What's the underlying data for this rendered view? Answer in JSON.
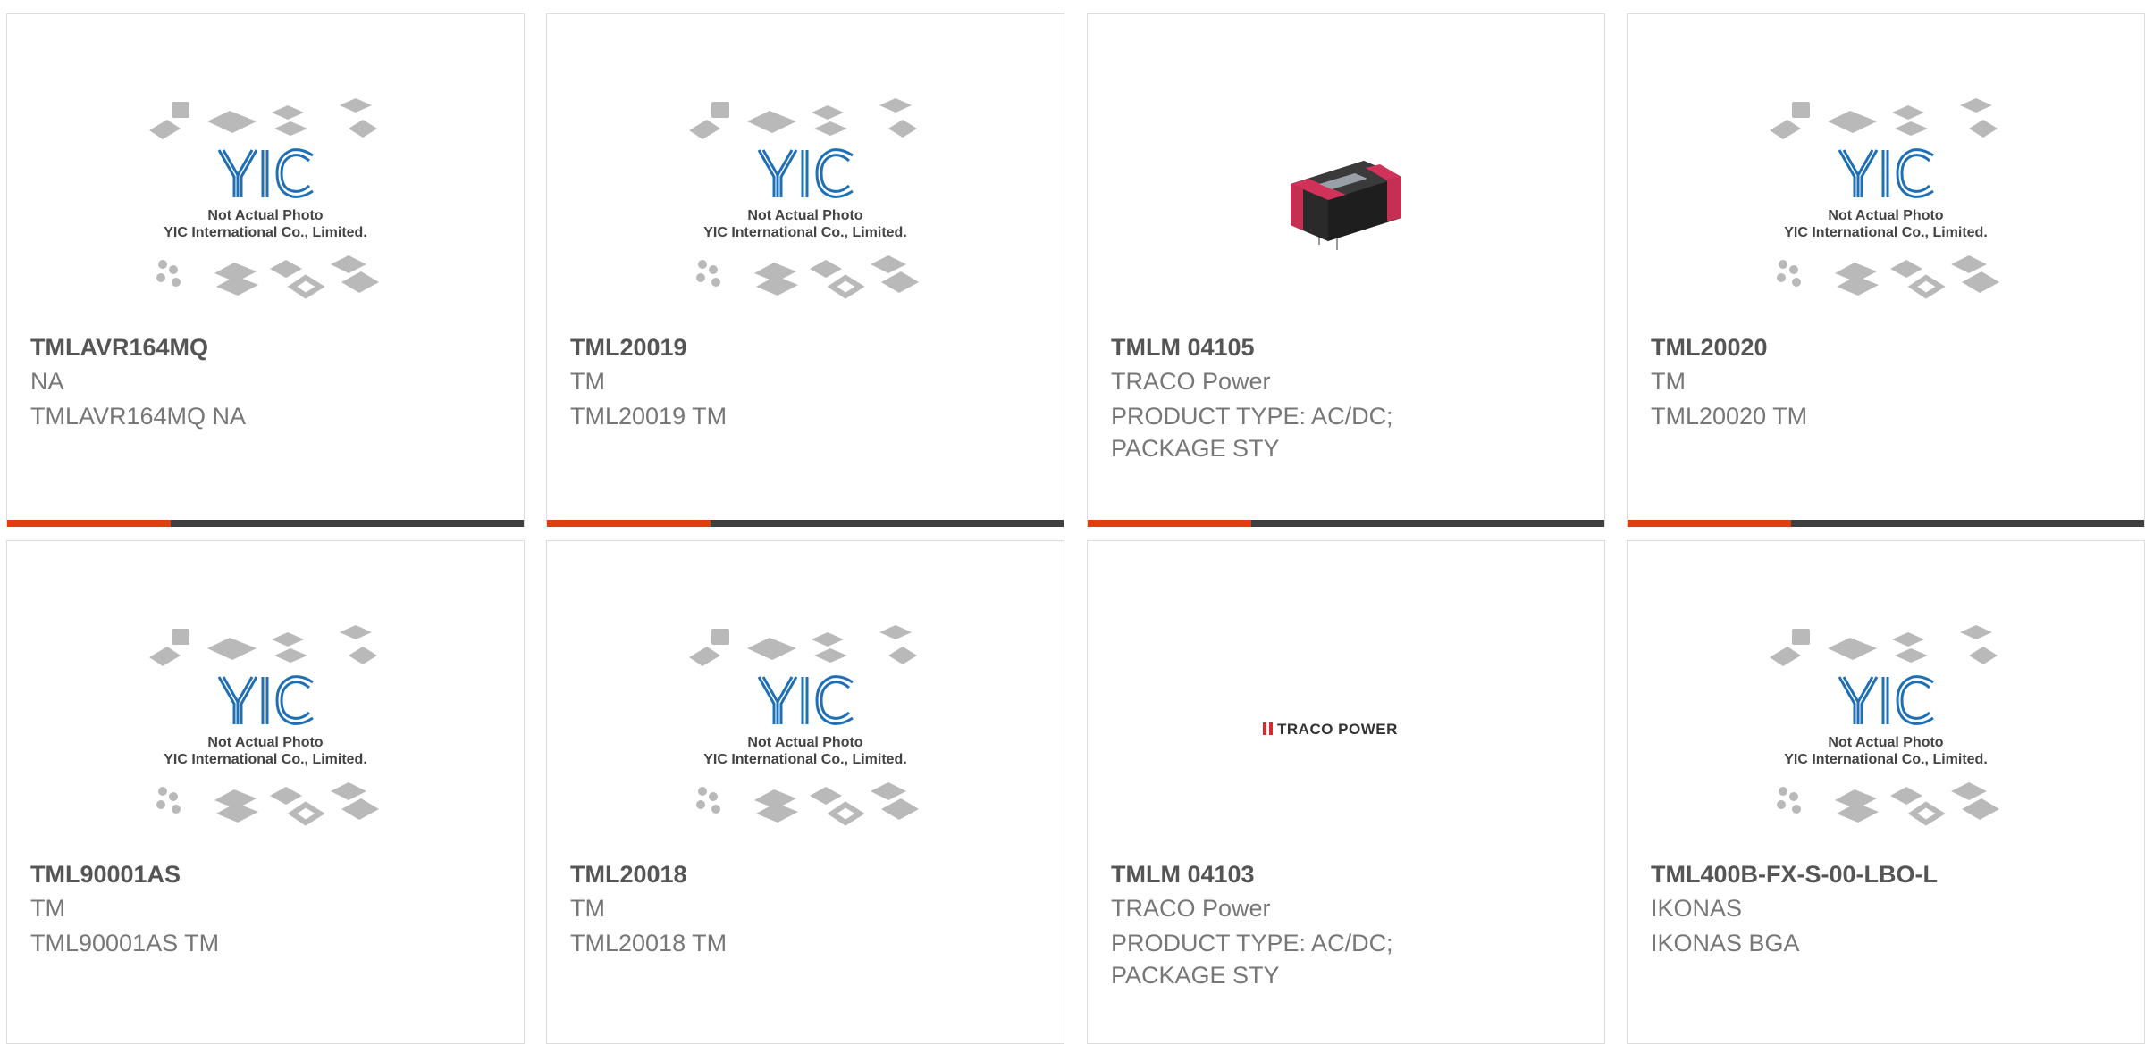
{
  "placeholder": {
    "logo_text": "YIC",
    "caption_line1": "Not Actual Photo",
    "caption_line2": "YIC International Co., Limited."
  },
  "traco_logo_text": "TRACO POWER",
  "colors": {
    "accent": "#e03e10",
    "bar": "#3f3f3f",
    "border": "#dcdcdc",
    "title": "#555555",
    "text": "#777777",
    "logo_blue": "#1f6fb5",
    "traco_red": "#d62b2b"
  },
  "products": [
    {
      "title": "TMLAVR164MQ",
      "brand": "NA",
      "desc": "TMLAVR164MQ NA",
      "image": "placeholder"
    },
    {
      "title": "TML20019",
      "brand": "TM",
      "desc": "TML20019 TM",
      "image": "placeholder"
    },
    {
      "title": "TMLM 04105",
      "brand": "TRACO Power",
      "desc": "PRODUCT TYPE: AC/DC; PACKAGE STY",
      "image": "module-photo"
    },
    {
      "title": "TML20020",
      "brand": "TM",
      "desc": "TML20020 TM",
      "image": "placeholder"
    },
    {
      "title": "TML90001AS",
      "brand": "TM",
      "desc": "TML90001AS TM",
      "image": "placeholder"
    },
    {
      "title": "TML20018",
      "brand": "TM",
      "desc": "TML20018 TM",
      "image": "placeholder"
    },
    {
      "title": "TMLM 04103",
      "brand": "TRACO Power",
      "desc": "PRODUCT TYPE: AC/DC; PACKAGE STY",
      "image": "traco-logo"
    },
    {
      "title": "TML400B-FX-S-00-LBO-L",
      "brand": "IKONAS",
      "desc": "IKONAS BGA",
      "image": "placeholder"
    }
  ]
}
